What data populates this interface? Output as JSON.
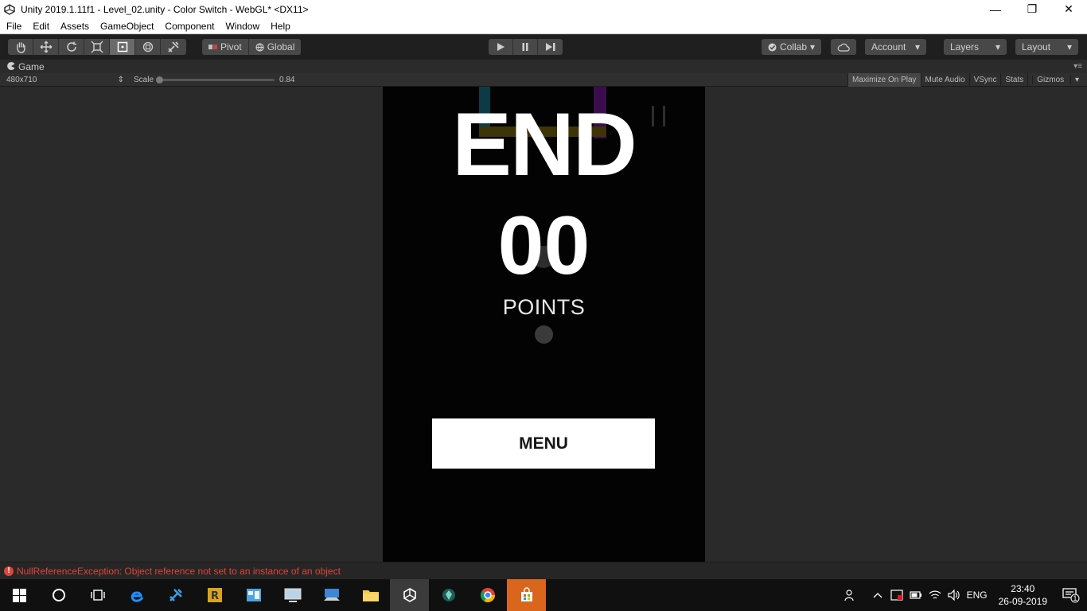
{
  "window": {
    "title": "Unity 2019.1.11f1 - Level_02.unity - Color Switch - WebGL* <DX11>",
    "minimize_glyph": "—",
    "restore_glyph": "❐",
    "close_glyph": "✕"
  },
  "menu": {
    "items": [
      "File",
      "Edit",
      "Assets",
      "GameObject",
      "Component",
      "Window",
      "Help"
    ]
  },
  "toolbar": {
    "pivot_label": "Pivot",
    "global_label": "Global",
    "collab_label": "Collab",
    "account_label": "Account",
    "layers_label": "Layers",
    "layout_label": "Layout",
    "dropdown_glyph": "▾"
  },
  "game_tab": {
    "label": "Game",
    "resolution": "480x710",
    "scale_label": "Scale",
    "scale_value": "0.84",
    "scale_fraction": 0.0,
    "toggles": [
      "Maximize On Play",
      "Mute Audio",
      "VSync",
      "Stats",
      "Gizmos"
    ],
    "gizmos_dropdown": "▾"
  },
  "game": {
    "end_text": "END",
    "score": "00",
    "points_label": "POINTS",
    "menu_button": "MENU"
  },
  "status": {
    "error_message": "NullReferenceException: Object reference not set to an instance of an object",
    "error_glyph": "!"
  },
  "taskbar": {
    "language": "ENG",
    "time": "23:40",
    "date": "26-09-2019",
    "notification_count": "1"
  },
  "colors": {
    "accent_error": "#e0443a",
    "game_bg": "#030303",
    "editor_bg": "#2a2a2a"
  }
}
